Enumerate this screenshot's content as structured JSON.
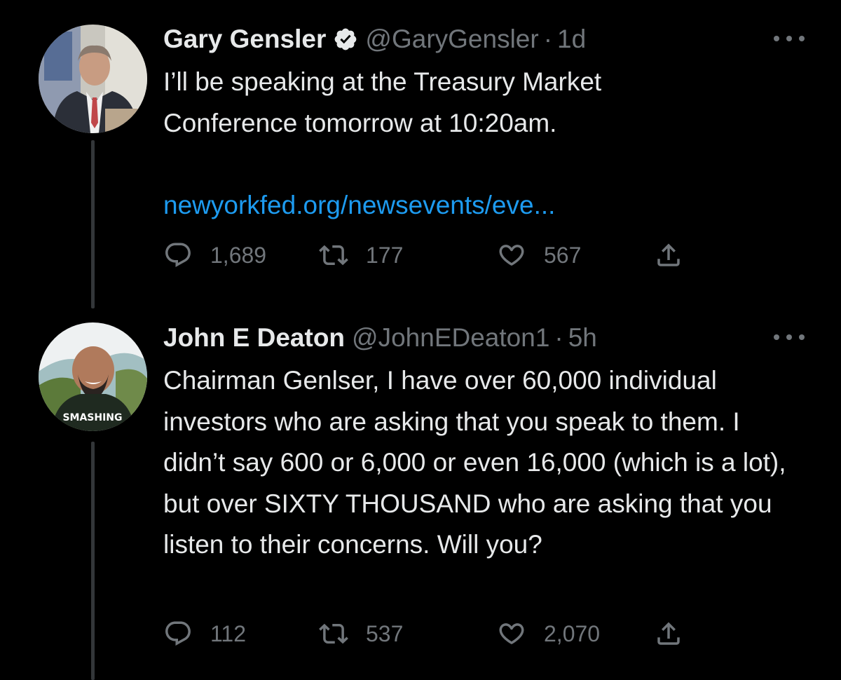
{
  "tweets": [
    {
      "display_name": "Gary Gensler",
      "verified": true,
      "handle": "@GaryGensler",
      "separator": "·",
      "time": "1d",
      "text": "I’ll be speaking at the Treasury Market Conference tomorrow at 10:20am.",
      "link": "newyorkfed.org/newsevents/eve...",
      "replies": "1,689",
      "retweets": "177",
      "likes": "567"
    },
    {
      "display_name": "John E Deaton",
      "verified": false,
      "handle": "@JohnEDeaton1",
      "separator": "·",
      "time": "5h",
      "text": "Chairman Genlser, I have over 60,000 individual investors who are asking that you speak to them. I didn’t say 600 or 6,000 or even 16,000 (which is a lot), but over SIXTY THOUSAND who are asking that you listen to their concerns. Will you?",
      "replies": "112",
      "retweets": "537",
      "likes": "2,070"
    }
  ],
  "avatar_text": "SMASHING",
  "icons": {
    "verified": "verified-badge-icon",
    "more": "more-horizontal-icon",
    "reply": "reply-bubble-icon",
    "retweet": "retweet-icon",
    "like": "heart-icon",
    "share": "share-upload-icon"
  },
  "colors": {
    "background": "#000000",
    "text": "#e7e9ea",
    "muted": "#71767b",
    "link": "#1d9bf0",
    "thread_line": "#333639"
  }
}
